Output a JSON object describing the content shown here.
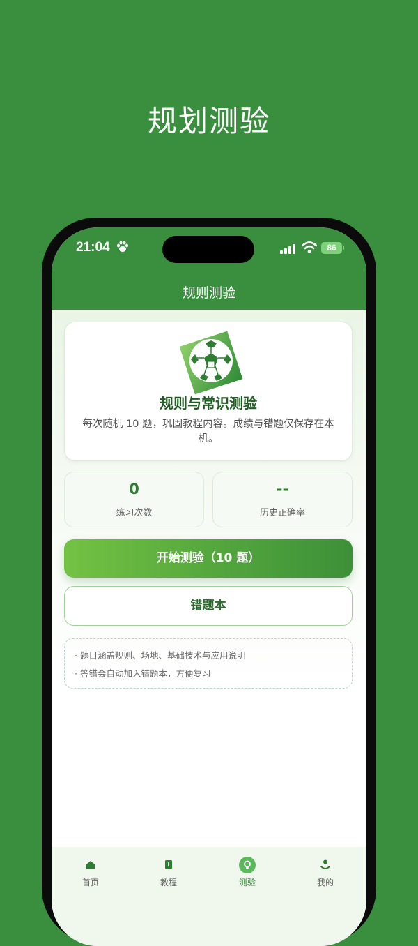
{
  "promo": {
    "title": "规划测验"
  },
  "status": {
    "time": "21:04",
    "battery": "86"
  },
  "nav": {
    "title": "规则测验"
  },
  "intro": {
    "title": "规则与常识测验",
    "description": "每次随机 10 题，巩固教程内容。成绩与错题仅保存在本机。"
  },
  "stats": [
    {
      "value": "0",
      "label": "练习次数"
    },
    {
      "value": "--",
      "label": "历史正确率"
    }
  ],
  "actions": {
    "start": "开始测验（10 题）",
    "wrong_book": "错题本"
  },
  "tips": [
    "· 题目涵盖规则、场地、基础技术与应用说明",
    "· 答错会自动加入错题本，方便复习"
  ],
  "tabs": [
    {
      "label": "首页",
      "icon": "home-icon"
    },
    {
      "label": "教程",
      "icon": "book-icon"
    },
    {
      "label": "测验",
      "icon": "bulb-icon",
      "active": true
    },
    {
      "label": "我的",
      "icon": "person-icon"
    }
  ],
  "colors": {
    "brand": "#3a8f3e",
    "accent_light": "#74c244",
    "title_dark": "#1f5d22"
  }
}
